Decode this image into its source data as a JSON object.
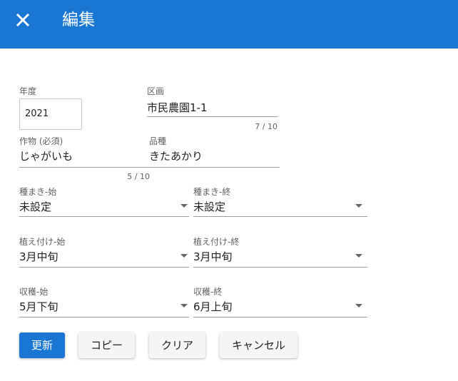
{
  "appbar": {
    "title": "編集",
    "close_icon": "close-icon",
    "bg": "#1976d2"
  },
  "form": {
    "year": {
      "label": "年度",
      "value": "2021"
    },
    "plot": {
      "label": "区画",
      "value": "市民農園1-1",
      "counter": "7 / 10"
    },
    "crop": {
      "label": "作物 (必須)",
      "value": "じゃがいも",
      "counter": "5 / 10"
    },
    "variety": {
      "label": "品種",
      "value": "きたあかり"
    },
    "sowing_start": {
      "label": "種まき-始",
      "value": "未設定"
    },
    "sowing_end": {
      "label": "種まき-終",
      "value": "未設定"
    },
    "planting_start": {
      "label": "植え付け-始",
      "value": "3月中旬"
    },
    "planting_end": {
      "label": "植え付け-終",
      "value": "3月中旬"
    },
    "harvest_start": {
      "label": "収穫-始",
      "value": "5月下旬"
    },
    "harvest_end": {
      "label": "収穫-終",
      "value": "6月上旬"
    }
  },
  "buttons": {
    "update": "更新",
    "copy": "コピー",
    "clear": "クリア",
    "cancel": "キャンセル"
  }
}
